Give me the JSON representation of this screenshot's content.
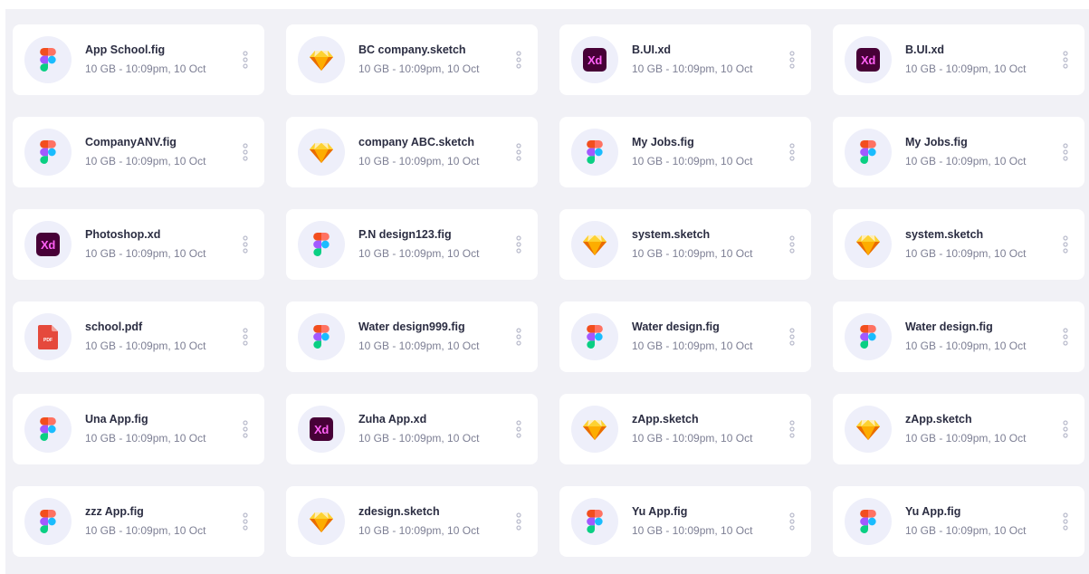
{
  "files": [
    {
      "name": "App School.fig",
      "meta": "10 GB - 10:09pm, 10 Oct",
      "icon": "figma-icon"
    },
    {
      "name": "BC company.sketch",
      "meta": "10 GB - 10:09pm, 10 Oct",
      "icon": "sketch-icon"
    },
    {
      "name": "B.UI.xd",
      "meta": "10 GB - 10:09pm, 10 Oct",
      "icon": "xd-icon"
    },
    {
      "name": "B.UI.xd",
      "meta": "10 GB - 10:09pm, 10 Oct",
      "icon": "xd-icon"
    },
    {
      "name": "CompanyANV.fig",
      "meta": "10 GB - 10:09pm, 10 Oct",
      "icon": "figma-icon"
    },
    {
      "name": "company ABC.sketch",
      "meta": "10 GB - 10:09pm, 10 Oct",
      "icon": "sketch-icon"
    },
    {
      "name": "My Jobs.fig",
      "meta": "10 GB - 10:09pm, 10 Oct",
      "icon": "figma-icon"
    },
    {
      "name": "My Jobs.fig",
      "meta": "10 GB - 10:09pm, 10 Oct",
      "icon": "figma-icon"
    },
    {
      "name": "Photoshop.xd",
      "meta": "10 GB - 10:09pm, 10 Oct",
      "icon": "xd-icon"
    },
    {
      "name": "P.N design123.fig",
      "meta": "10 GB - 10:09pm, 10 Oct",
      "icon": "figma-icon"
    },
    {
      "name": "system.sketch",
      "meta": "10 GB - 10:09pm, 10 Oct",
      "icon": "sketch-icon"
    },
    {
      "name": "system.sketch",
      "meta": "10 GB - 10:09pm, 10 Oct",
      "icon": "sketch-icon"
    },
    {
      "name": "school.pdf",
      "meta": "10 GB - 10:09pm, 10 Oct",
      "icon": "pdf-icon"
    },
    {
      "name": "Water design999.fig",
      "meta": "10 GB - 10:09pm, 10 Oct",
      "icon": "figma-icon"
    },
    {
      "name": "Water design.fig",
      "meta": "10 GB - 10:09pm, 10 Oct",
      "icon": "figma-icon"
    },
    {
      "name": "Water design.fig",
      "meta": "10 GB - 10:09pm, 10 Oct",
      "icon": "figma-icon"
    },
    {
      "name": "Una App.fig",
      "meta": "10 GB - 10:09pm, 10 Oct",
      "icon": "figma-icon"
    },
    {
      "name": "Zuha App.xd",
      "meta": "10 GB - 10:09pm, 10 Oct",
      "icon": "xd-icon"
    },
    {
      "name": "zApp.sketch",
      "meta": "10 GB - 10:09pm, 10 Oct",
      "icon": "sketch-icon"
    },
    {
      "name": "zApp.sketch",
      "meta": "10 GB - 10:09pm, 10 Oct",
      "icon": "sketch-icon"
    },
    {
      "name": "zzz App.fig",
      "meta": "10 GB - 10:09pm, 10 Oct",
      "icon": "figma-icon"
    },
    {
      "name": "zdesign.sketch",
      "meta": "10 GB - 10:09pm, 10 Oct",
      "icon": "sketch-icon"
    },
    {
      "name": "Yu App.fig",
      "meta": "10 GB - 10:09pm, 10 Oct",
      "icon": "figma-icon"
    },
    {
      "name": "Yu App.fig",
      "meta": "10 GB - 10:09pm, 10 Oct",
      "icon": "figma-icon"
    }
  ],
  "icon_labels": {
    "xd": "Xd",
    "pdf": "PDF"
  },
  "colors": {
    "panel_background": "#f1f1f6",
    "card_background": "#ffffff",
    "icon_circle": "#eeeffa",
    "file_name_text": "#2b2d42",
    "file_meta_text": "#7d7f94",
    "more_dots": "#b8bacb",
    "xd_background": "#470137",
    "xd_text": "#ff61f6",
    "pdf_red": "#e5493c",
    "sketch_yellow": "#fdb300"
  }
}
